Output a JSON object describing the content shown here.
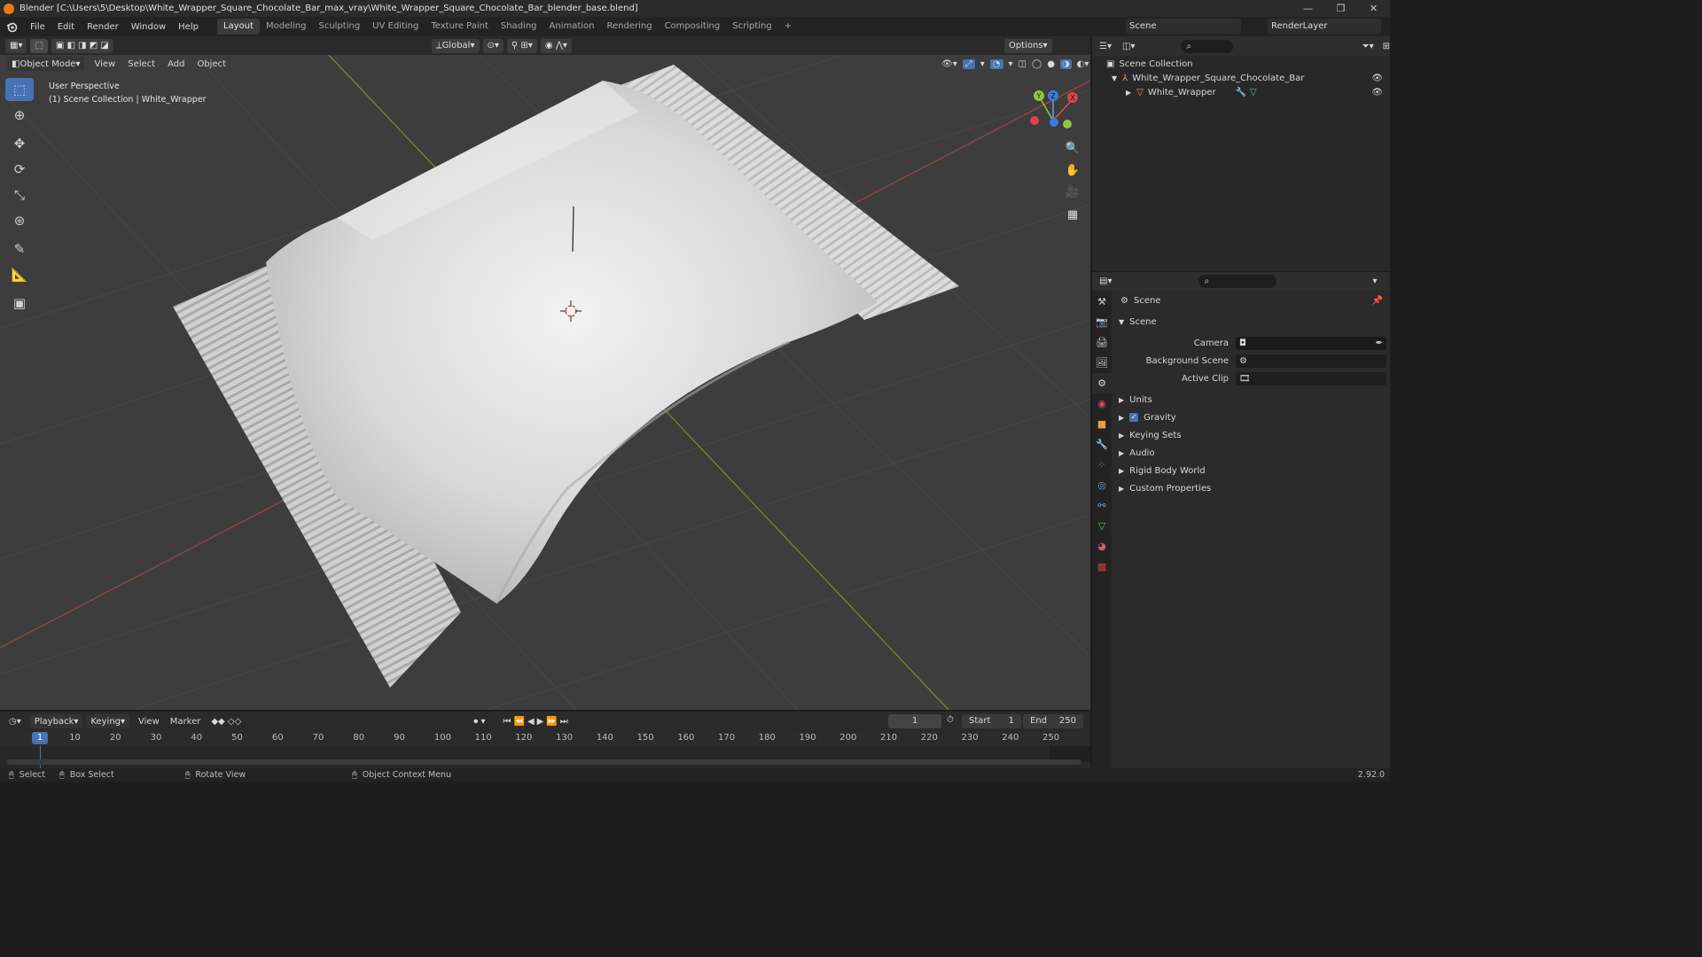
{
  "titlebar": {
    "title": "Blender [C:\\Users\\5\\Desktop\\White_Wrapper_Square_Chocolate_Bar_max_vray\\White_Wrapper_Square_Chocolate_Bar_blender_base.blend]",
    "minimize": "—",
    "maximize": "❐",
    "close": "✕"
  },
  "menu": [
    "File",
    "Edit",
    "Render",
    "Window",
    "Help"
  ],
  "workspaces": [
    "Layout",
    "Modeling",
    "Sculpting",
    "UV Editing",
    "Texture Paint",
    "Shading",
    "Animation",
    "Rendering",
    "Compositing",
    "Scripting",
    "+"
  ],
  "top": {
    "scene": "Scene",
    "render_layer": "RenderLayer"
  },
  "viewport_header": {
    "mode": "Object Mode",
    "menus": [
      "View",
      "Select",
      "Add",
      "Object"
    ],
    "transform": "Global",
    "options": "Options"
  },
  "viewport": {
    "perspective": "User Perspective",
    "collection": "(1) Scene Collection | White_Wrapper"
  },
  "gizmo": {
    "y": "Y",
    "z": "Z",
    "x": "X"
  },
  "outliner": {
    "root": "Scene Collection",
    "items": [
      {
        "label": "White_Wrapper_Square_Chocolate_Bar"
      },
      {
        "label": "White_Wrapper"
      }
    ]
  },
  "properties": {
    "breadcrumb": "Scene",
    "panel": "Scene",
    "fields": [
      {
        "label": "Camera"
      },
      {
        "label": "Background Scene"
      },
      {
        "label": "Active Clip"
      }
    ],
    "sections": [
      "Units",
      "Gravity",
      "Keying Sets",
      "Audio",
      "Rigid Body World",
      "Custom Properties"
    ]
  },
  "timeline": {
    "menus": [
      "Playback",
      "Keying",
      "View",
      "Marker"
    ],
    "current_frame": "1",
    "start_label": "Start",
    "start": "1",
    "end_label": "End",
    "end": "250",
    "ticks": [
      "1",
      "10",
      "20",
      "30",
      "40",
      "50",
      "60",
      "70",
      "80",
      "90",
      "100",
      "110",
      "120",
      "130",
      "140",
      "150",
      "160",
      "170",
      "180",
      "190",
      "200",
      "210",
      "220",
      "230",
      "240",
      "250"
    ]
  },
  "status": {
    "select": "Select",
    "box_select": "Box Select",
    "rotate": "Rotate View",
    "context": "Object Context Menu",
    "version": "2.92.0"
  }
}
